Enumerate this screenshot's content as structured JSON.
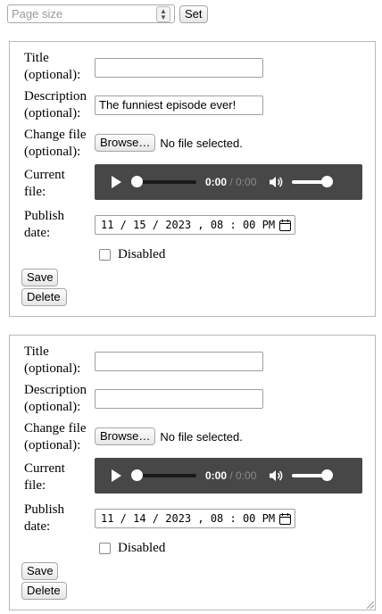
{
  "top": {
    "page_size_placeholder": "Page size",
    "set_label": "Set"
  },
  "labels": {
    "title": "Title (optional):",
    "description": "Description (optional):",
    "change_file": "Change file (optional):",
    "current_file": "Current file:",
    "publish_date": "Publish date:",
    "disabled": "Disabled",
    "browse": "Browse…",
    "no_file": "No file selected.",
    "save": "Save",
    "delete": "Delete"
  },
  "episodes": [
    {
      "title_value": "",
      "description_value": "The funniest episode ever!",
      "current_time": "0:00",
      "duration": "0:00",
      "publish_date": "11 / 15 / 2023 ,  08 : 00   PM",
      "disabled": false
    },
    {
      "title_value": "",
      "description_value": "",
      "current_time": "0:00",
      "duration": "0:00",
      "publish_date": "11 / 14 / 2023 ,  08 : 00   PM",
      "disabled": false
    }
  ]
}
